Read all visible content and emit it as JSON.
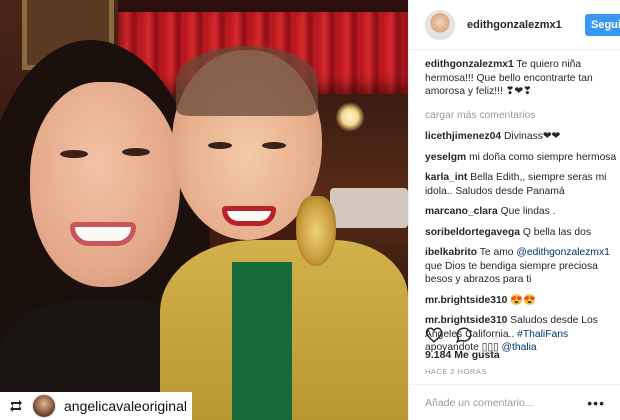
{
  "post": {
    "credit_username": "angelicavaleoriginal"
  },
  "sidebar": {
    "username": "edithgonzalezmx1",
    "follow_label": "Seguir",
    "caption": {
      "username": "edithgonzalezmx1",
      "text": "Te quiero niña hermosa!!! Que bello encontrarte tan amorosa y feliz!!! ❣❤❣"
    },
    "load_more": "cargar más comentarios",
    "comments": [
      {
        "username": "licethjimenez04",
        "text": "Divinass❤❤"
      },
      {
        "username": "yeselgm",
        "text": "mi doña como siempre hermosa"
      },
      {
        "username": "karla_int",
        "text": "Bella Edith,, siempre seras mi idola.. Saludos desde Panamá"
      },
      {
        "username": "marcano_clara",
        "text": "Que lindas ."
      },
      {
        "username": "soribeldortegavega",
        "text": "Q bella las dos"
      },
      {
        "username": "ibelkabrito",
        "text_before": "Te amo ",
        "mention": "@edithgonzalezmx1",
        "text_after": " que Dios te bendiga siempre preciosa besos y abrazos para ti"
      },
      {
        "username": "mr.brightside310",
        "text": "😍😍"
      },
      {
        "username": "mr.brightside310",
        "text_before": "Saludos desde Los Angeles California.. ",
        "mention": "#ThaliFans",
        "text_after": " apoyandote ▯▯▯ ",
        "mention2": "@thalia"
      }
    ],
    "likes": "9.184 Me gusta",
    "time_ago": "HACE 2 HORAS",
    "add_comment_placeholder": "Añade un comentario...",
    "more_icon": "more-dots-icon"
  },
  "colors": {
    "accent": "#3897f0",
    "mention": "#003569",
    "muted": "#999999"
  }
}
